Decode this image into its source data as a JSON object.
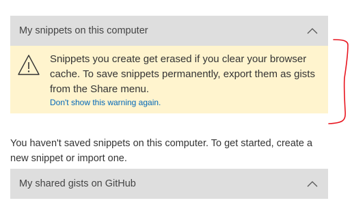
{
  "sections": {
    "local": {
      "title": "My snippets on this computer",
      "chevron_icon": "chevron-up-icon"
    },
    "gists": {
      "title": "My shared gists on GitHub",
      "chevron_icon": "chevron-up-icon"
    }
  },
  "warning": {
    "icon": "warning-triangle-icon",
    "message": "Snippets you create get erased if you clear your browser cache. To save snippets permanently, export them as gists from the Share menu.",
    "dismiss_link": "Don't show this warning again."
  },
  "empty_state": {
    "text": "You haven't saved snippets on this computer. To get started, create a new snippet or import one."
  },
  "colors": {
    "header_bg": "#dedede",
    "warning_bg": "#fff4ce",
    "link": "#0067b8",
    "annotation": "#e8141e"
  }
}
